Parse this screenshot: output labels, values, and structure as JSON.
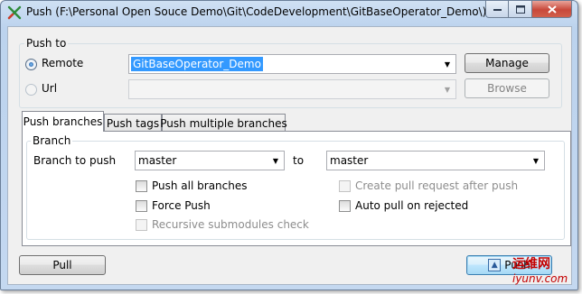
{
  "window": {
    "title": "Push (F:\\Personal Open Souce Demo\\Git\\CodeDevelopment\\GitBaseOperator_Demo\\)",
    "icon": "git-extensions-icon"
  },
  "push_to": {
    "group_label": "Push to",
    "remote_label": "Remote",
    "remote_value": "GitBaseOperator_Demo",
    "remote_selected": true,
    "url_label": "Url",
    "url_value": "",
    "manage_label": "Manage",
    "browse_label": "Browse"
  },
  "tabs": [
    "Push branches",
    "Push tags",
    "Push multiple branches"
  ],
  "active_tab": "Push branches",
  "branch": {
    "group_label": "Branch",
    "branch_to_push_label": "Branch to push",
    "local_branch": "master",
    "to_label": "to",
    "remote_branch": "master",
    "options": {
      "push_all_branches": "Push all branches",
      "force_push": "Force Push",
      "recursive_submodules": "Recursive submodules check",
      "create_pull_request": "Create pull request after push",
      "auto_pull": "Auto pull on rejected"
    }
  },
  "footer": {
    "pull_label": "Pull",
    "push_label": "Push"
  },
  "overlay": {
    "watermark_text": "运维网",
    "watermark_url": "iyunv.com"
  },
  "colors": {
    "selection": "#3399ff",
    "watermark": "#c40000"
  }
}
